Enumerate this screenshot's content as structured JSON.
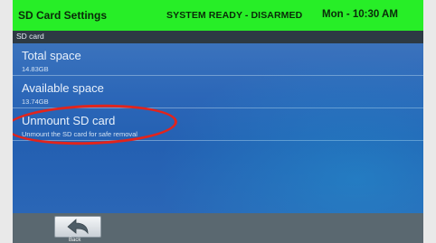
{
  "header": {
    "title": "SD Card Settings",
    "status": "SYSTEM READY - DISARMED",
    "clock": "Mon - 10:30 AM",
    "accent_color": "#27ee27"
  },
  "section": {
    "title": "SD card"
  },
  "rows": [
    {
      "label": "Total space",
      "value": "14.83GB"
    },
    {
      "label": "Available space",
      "value": "13.74GB"
    },
    {
      "label": "Unmount SD card",
      "value": "Unmount the SD card for safe removal"
    }
  ],
  "footer": {
    "back_label": "Back",
    "back_icon": "back-arrow-icon"
  },
  "annotation": {
    "color": "#e2241c",
    "target": "Unmount SD card"
  }
}
